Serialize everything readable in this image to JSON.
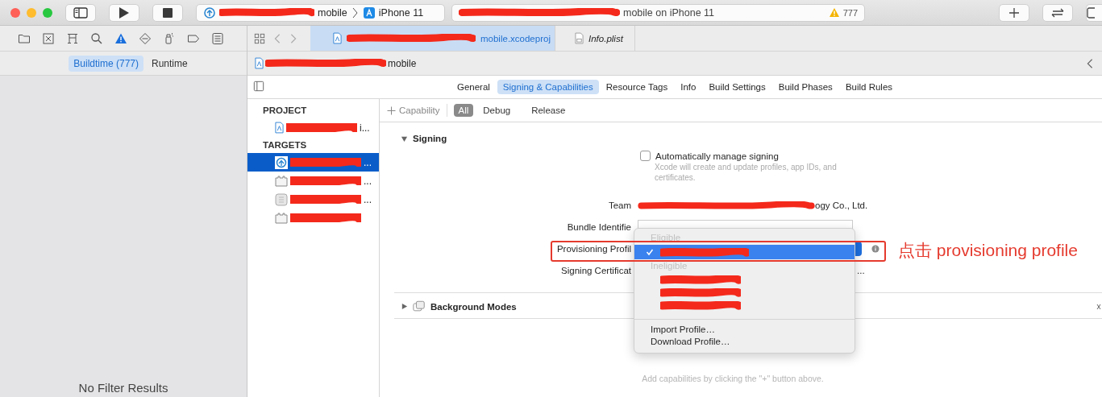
{
  "toolbar": {
    "scheme": {
      "target": "mobile",
      "device": "iPhone 11"
    },
    "activity": {
      "text": "mobile on iPhone 11",
      "warnings": "777"
    }
  },
  "navigator": {
    "filters": [
      {
        "label": "Buildtime (777)",
        "selected": true
      },
      {
        "label": "Runtime",
        "selected": false
      }
    ],
    "empty_text": "No Filter Results"
  },
  "editor_tabs": [
    {
      "label": "mobile.xcodeproj",
      "selected": true,
      "kind": "project"
    },
    {
      "label": "Info.plist",
      "selected": false,
      "kind": "plist"
    }
  ],
  "jump_bar": {
    "text": "mobile"
  },
  "settings_tabs": [
    {
      "label": "General",
      "selected": false
    },
    {
      "label": "Signing & Capabilities",
      "selected": true
    },
    {
      "label": "Resource Tags",
      "selected": false
    },
    {
      "label": "Info",
      "selected": false
    },
    {
      "label": "Build Settings",
      "selected": false
    },
    {
      "label": "Build Phases",
      "selected": false
    },
    {
      "label": "Build Rules",
      "selected": false
    }
  ],
  "sidebar": {
    "sections": [
      {
        "title": "PROJECT",
        "items": [
          {
            "text": "i...",
            "kind": "project",
            "selected": false
          }
        ]
      },
      {
        "title": "TARGETS",
        "items": [
          {
            "text": "...",
            "kind": "app",
            "selected": true
          },
          {
            "text": "...",
            "kind": "extension",
            "selected": false
          },
          {
            "text": "...",
            "kind": "bundle",
            "selected": false
          },
          {
            "kind": "extension",
            "selected": false
          }
        ]
      }
    ]
  },
  "capability_bar": {
    "add_label": "Capability",
    "filters": [
      {
        "label": "All",
        "selected": true
      },
      {
        "label": "Debug",
        "selected": false
      },
      {
        "label": "Release",
        "selected": false
      }
    ]
  },
  "signing": {
    "title": "Signing",
    "expanded": true,
    "auto_manage": {
      "label": "Automatically manage signing",
      "checked": false,
      "hint": "Xcode will create and update profiles, app IDs, and certificates."
    },
    "fields": [
      {
        "label": "Team",
        "kind": "text",
        "value": "ogy Co., Ltd."
      },
      {
        "label": "Bundle Identifie",
        "kind": "input"
      },
      {
        "label": "Provisioning Profil",
        "kind": "popup"
      },
      {
        "label": "Signing Certificat",
        "kind": "text",
        "value": "..."
      }
    ]
  },
  "background_modes": {
    "title": "Background Modes",
    "expanded": false
  },
  "footer_hint": "Add capabilities by clicking the \"+\" button above.",
  "popup_menu": {
    "sections": [
      {
        "header": "Eligible",
        "items": [
          {
            "checked": true,
            "selected": true
          }
        ]
      },
      {
        "header": "Ineligible",
        "items": [
          {
            "checked": false,
            "selected": false
          },
          {
            "checked": false,
            "selected": false
          },
          {
            "checked": false,
            "selected": false
          }
        ]
      }
    ],
    "actions": [
      "Import Profile…",
      "Download Profile…"
    ]
  },
  "annotation": {
    "text": "点击 provisioning profile"
  }
}
